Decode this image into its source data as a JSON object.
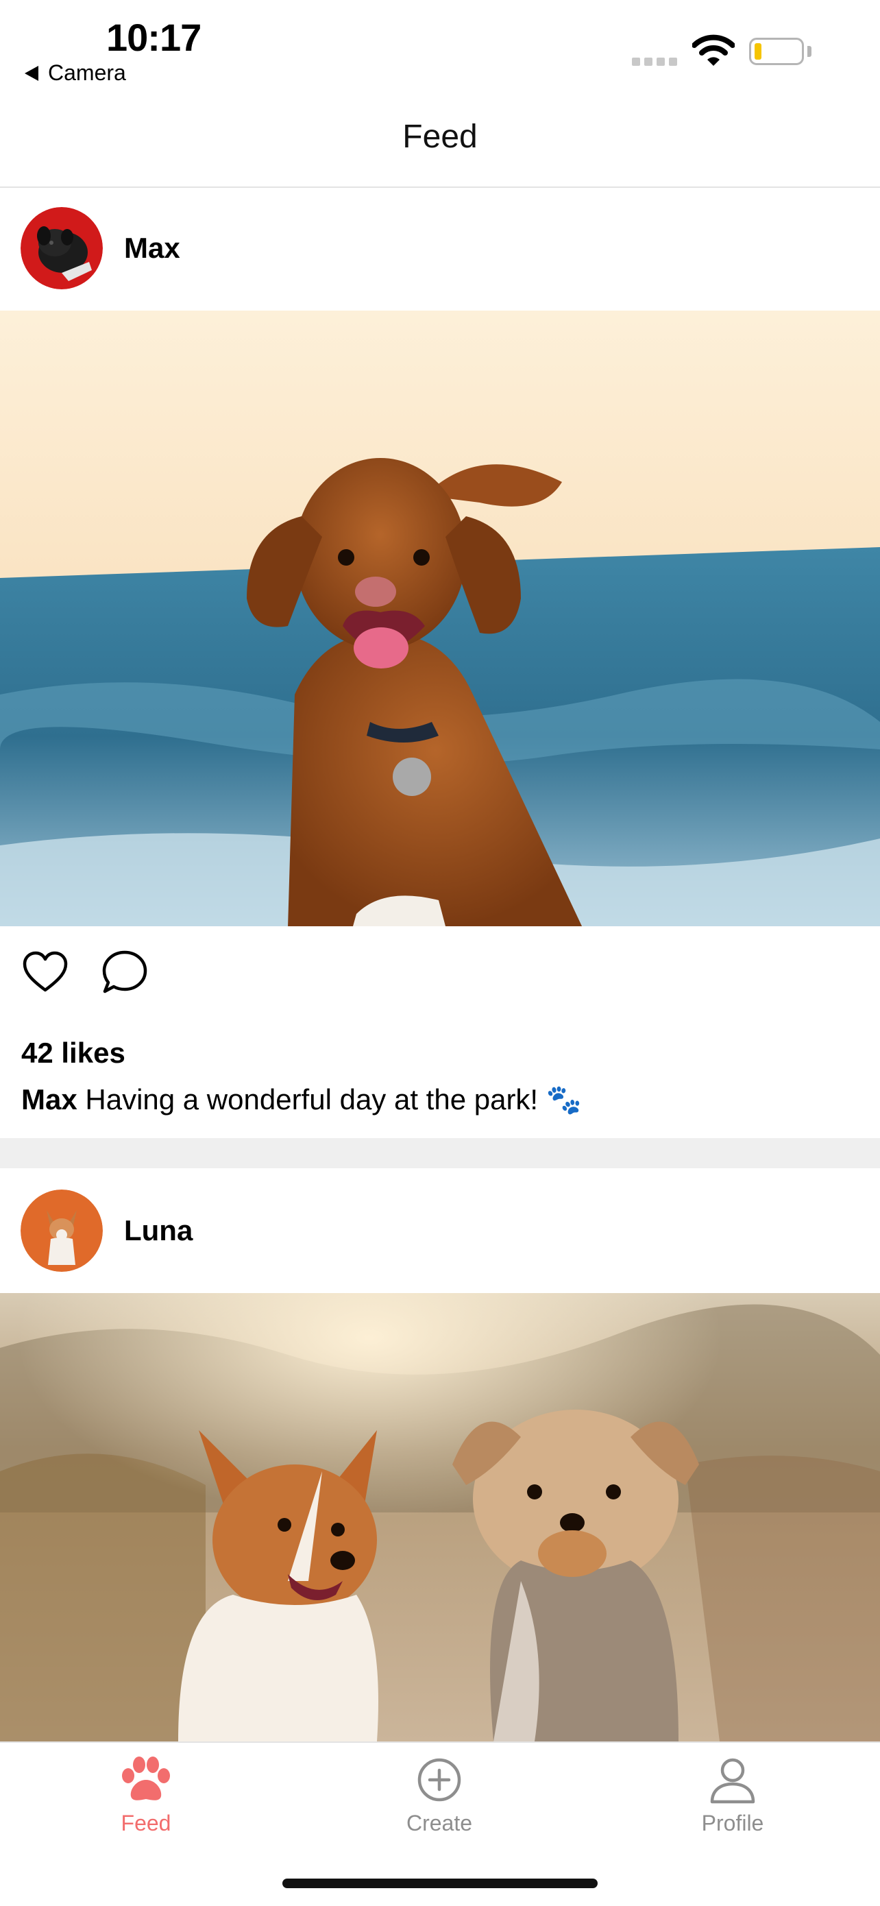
{
  "status_bar": {
    "time": "10:17",
    "back_label": "Camera"
  },
  "nav": {
    "title": "Feed"
  },
  "posts": [
    {
      "username": "Max",
      "likes": "42 likes",
      "caption_user": "Max",
      "caption_text": "Having a wonderful day at the park! 🐾"
    },
    {
      "username": "Luna"
    }
  ],
  "tabs": [
    {
      "label": "Feed",
      "icon": "paw-icon",
      "active": true
    },
    {
      "label": "Create",
      "icon": "plus-circle-icon",
      "active": false
    },
    {
      "label": "Profile",
      "icon": "person-icon",
      "active": false
    }
  ],
  "colors": {
    "accent": "#f26d6d",
    "inactive": "#8e8e8e",
    "divider": "#efefef"
  }
}
